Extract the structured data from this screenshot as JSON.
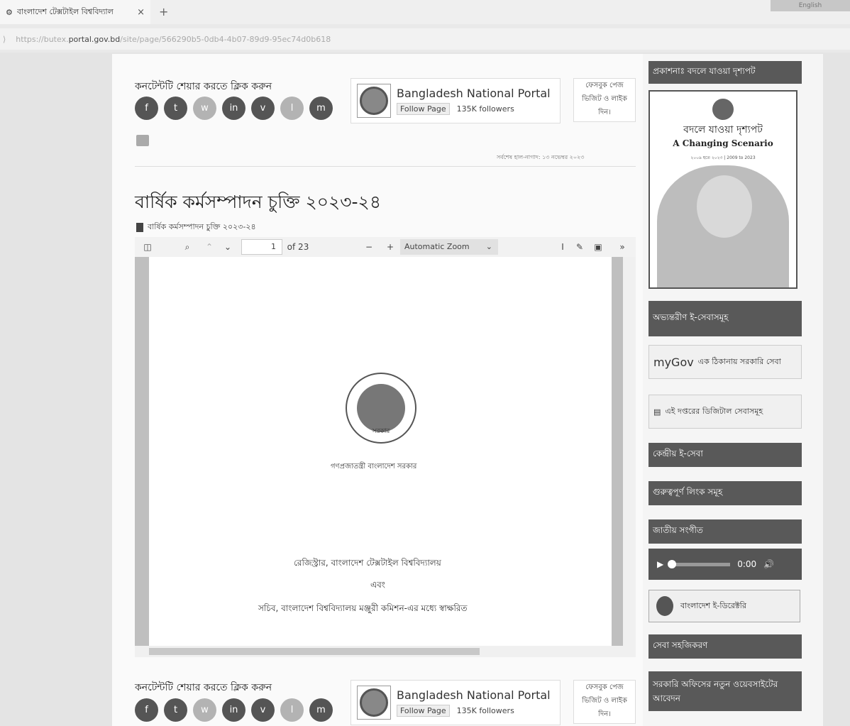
{
  "browser": {
    "tab_title": "বাংলাদেশ টেক্সটাইল বিশ্ববিদ্যাল",
    "close_glyph": "×",
    "new_tab_glyph": "+",
    "lang_button": "English",
    "url_prefix": "https://butex.",
    "url_domain": "portal.gov.bd",
    "url_path": "/site/page/566290b5-0db4-4b07-89d9-95ec74d0b618"
  },
  "share": {
    "title": "কনটেন্টটি শেয়ার করতে ক্লিক করুন",
    "buttons": [
      "f",
      "t",
      "w",
      "in",
      "v",
      "l",
      "m"
    ]
  },
  "facebook": {
    "page_name": "Bangladesh National Portal",
    "follow_label": "Follow Page",
    "followers": "135K followers",
    "note_line1": "ফেসবুক পেজ",
    "note_line2": "ভিজিট ও লাইক",
    "note_line3": "দিন।"
  },
  "updated_text": "সর্বশেষ হাল-নাগাদ: ১৩ নভেম্বর ২০২৩",
  "page_title": "বার্ষিক কর্মসম্পাদন চুক্তি ২০২৩-২৪",
  "attachment": "বার্ষিক কর্মসম্পাদন চুক্তি ২০২৩-২৪",
  "pdf": {
    "page_number": "1",
    "page_total": "of 23",
    "zoom": "Automatic Zoom",
    "seal_text": "সরকার",
    "line_gov": "গণপ্রজাতন্ত্রী বাংলাদেশ সরকার",
    "line_registrar": "রেজিস্ট্রার, বাংলাদেশ টেক্সটাইল বিশ্ববিদ্যালয়",
    "line_and": "এবং",
    "line_secretary": "সচিব, বাংলাদেশ বিশ্ববিদ্যালয় মঞ্জুরী কমিশন-এর মধ্যে স্বাক্ষরিত"
  },
  "sidebar": {
    "heading_publication": "প্রকাশনাঃ বদলে যাওয়া দৃশ্যপট",
    "poster_bn": "বদলে যাওয়া দৃশ্যপট",
    "poster_en": "A Changing Scenario",
    "poster_years": "২০০৯ হতে ২০২৩ | 2009 to 2023",
    "heading_eservices": "অভ্যন্তরীণ ই-সেবাসমূহ",
    "mygov_logo": "myGov",
    "mygov_tagline": "এক ঠিকানায় সরকারি সেবা",
    "digital_services": "এই দপ্তরের ডিজিটাল সেবাসমূহ",
    "central_eservice": "কেন্দ্রীয় ই-সেবা",
    "important_links": "গুরুত্বপূর্ণ লিংক সমূহ",
    "national_anthem": "জাতীয় সংগীত",
    "audio_time": "0:00",
    "edirectory": "বাংলাদেশ ই-ডিরেক্টরি",
    "service_simplify": "সেবা সহজিকরণ",
    "new_website_apply": "সরকারি অফিসের নতুন ওয়েবসাইটের আবেদন"
  }
}
